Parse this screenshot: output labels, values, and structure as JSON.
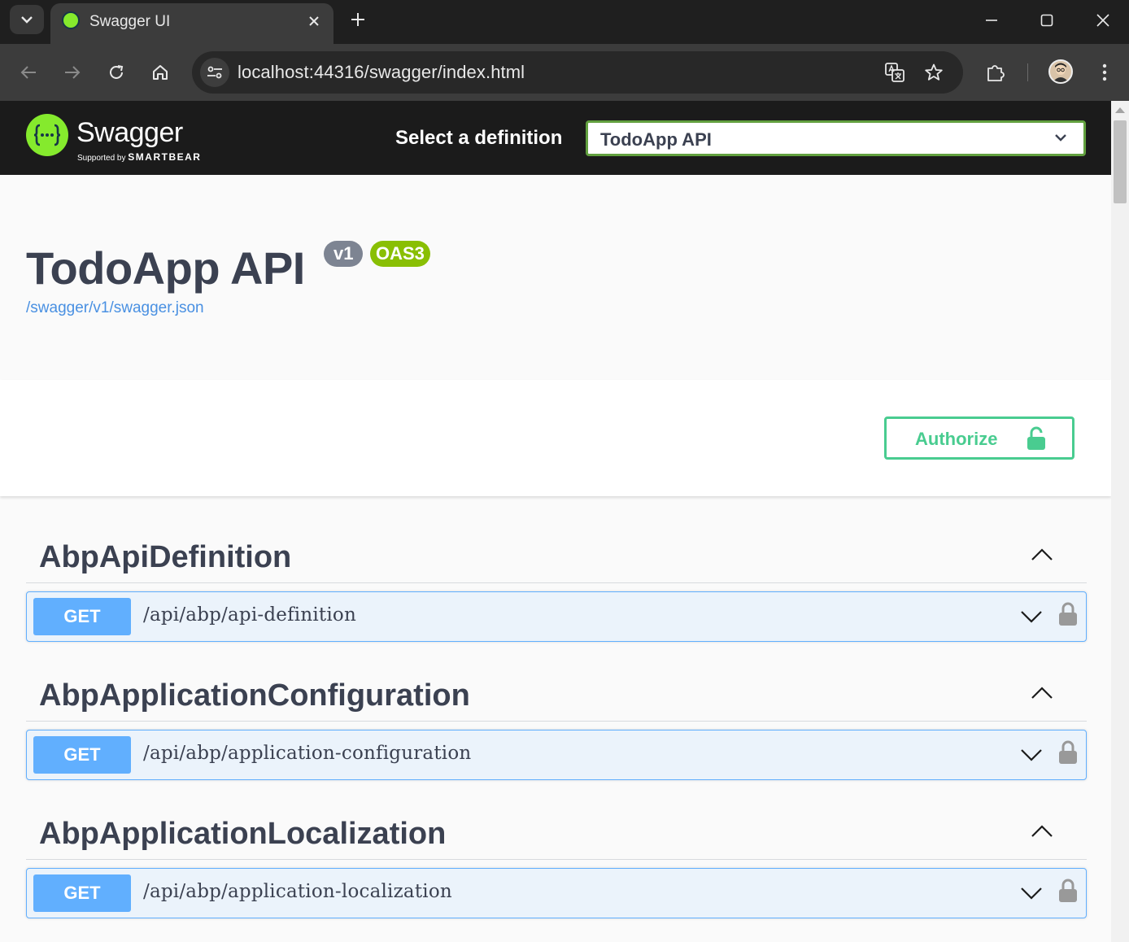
{
  "browser": {
    "tab_title": "Swagger UI",
    "url": "localhost:44316/swagger/index.html"
  },
  "topbar": {
    "logo_text": "Swagger",
    "logo_sub_prefix": "Supported by",
    "logo_sub_brand": "SMARTBEAR",
    "select_label": "Select a definition",
    "selected_definition": "TodoApp API"
  },
  "info": {
    "title": "TodoApp API",
    "version_badge": "v1",
    "oas_badge": "OAS3",
    "spec_link": "/swagger/v1/swagger.json"
  },
  "authorize": {
    "label": "Authorize"
  },
  "sections": [
    {
      "title": "AbpApiDefinition",
      "method": "GET",
      "path": "/api/abp/api-definition"
    },
    {
      "title": "AbpApplicationConfiguration",
      "method": "GET",
      "path": "/api/abp/application-configuration"
    },
    {
      "title": "AbpApplicationLocalization",
      "method": "GET",
      "path": "/api/abp/application-localization"
    }
  ],
  "colors": {
    "swagger_green": "#85ea2d",
    "get_blue": "#61affe",
    "authorize_green": "#49cc90",
    "oas_green": "#89bf04",
    "text_dark": "#3b4151"
  }
}
